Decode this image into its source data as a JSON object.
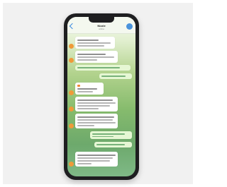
{
  "chat": {
    "title": "Nizzle",
    "subtitle": "online"
  },
  "colors": {
    "accent": "#3d8be0",
    "incoming_bubble": "#ffffff",
    "outgoing_bubble": "#e6f7d4",
    "avatar": "#ef9a3a",
    "wallpaper_top": "#e1efcf",
    "wallpaper_bottom": "#6da96c"
  },
  "icons": {
    "back": "chevron-left-icon",
    "contact_avatar": "avatar"
  },
  "messages": [
    {
      "direction": "incoming",
      "text": ""
    },
    {
      "direction": "incoming",
      "text": ""
    },
    {
      "direction": "outgoing",
      "text": ""
    },
    {
      "direction": "outgoing",
      "text": ""
    },
    {
      "direction": "incoming",
      "text": ""
    },
    {
      "direction": "incoming",
      "text": ""
    },
    {
      "direction": "incoming",
      "text": ""
    },
    {
      "direction": "outgoing",
      "text": ""
    },
    {
      "direction": "outgoing",
      "text": ""
    },
    {
      "direction": "incoming",
      "text": ""
    }
  ]
}
